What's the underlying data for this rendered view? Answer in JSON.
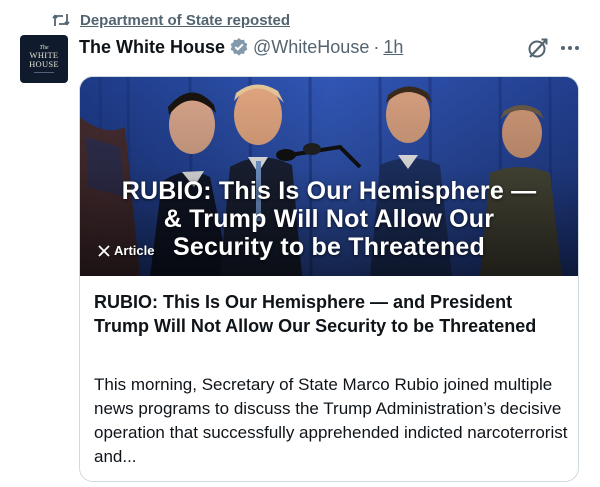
{
  "repost": {
    "icon": "repost-icon",
    "text": "Department of State reposted"
  },
  "author": {
    "avatar_lines": [
      "The",
      "WHITE",
      "HOUSE"
    ],
    "name": "The White House",
    "verified_icon": "verified-badge-icon",
    "verified_color": "#829aab",
    "handle": "@WhiteHouse",
    "separator": "·",
    "time": "1h"
  },
  "actions": {
    "grok_icon": "grok-icon",
    "more_icon": "more-options-icon"
  },
  "card": {
    "overlay_lines": [
      "RUBIO: This Is Our Hemisphere —",
      "& Trump Will Not Allow Our",
      "Security to be Threatened"
    ],
    "badge_icon": "x-logo-icon",
    "badge_label": "Article",
    "title": "RUBIO: This Is Our Hemisphere — and President Trump Will Not Allow Our Security to be Threatened",
    "description": "This morning, Secretary of State Marco Rubio joined multiple news programs to discuss the Trump Administration’s decisive operation that successfully apprehended indicted narcoterrorist and..."
  },
  "colors": {
    "text": "#0f1419",
    "muted": "#536471",
    "border": "#cfd9de",
    "curtain": "#2a4fa8"
  }
}
